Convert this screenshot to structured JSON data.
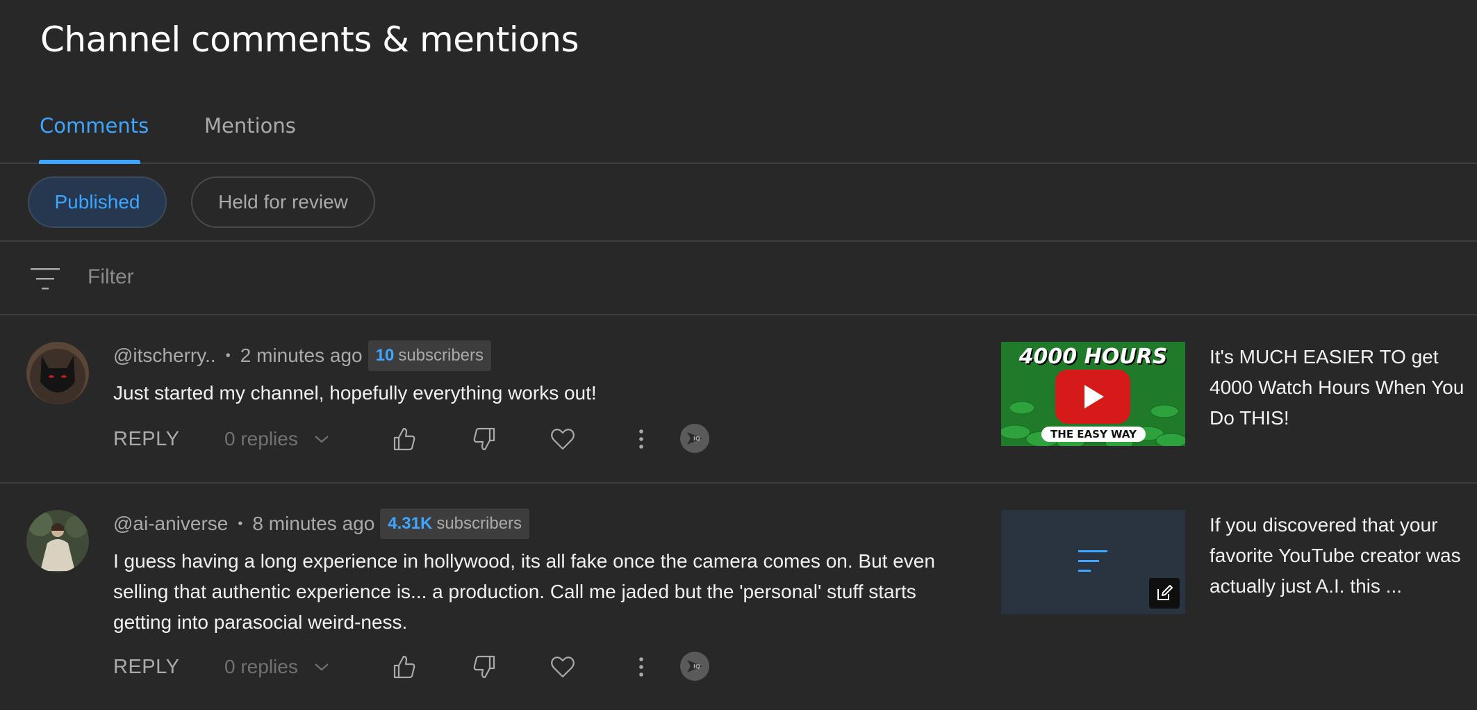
{
  "page": {
    "title": "Channel comments & mentions"
  },
  "tabs": [
    {
      "label": "Comments",
      "active": true
    },
    {
      "label": "Mentions",
      "active": false
    }
  ],
  "chips": [
    {
      "label": "Published",
      "active": true
    },
    {
      "label": "Held for review",
      "active": false
    }
  ],
  "filter": {
    "placeholder": "Filter",
    "value": "",
    "icon": "filter-icon"
  },
  "colors": {
    "accent": "#3ea6ff",
    "background": "#282828",
    "divider": "#3e3e3e"
  },
  "comments": [
    {
      "handle": "@itscherry..",
      "separator": "•",
      "time": "2 minutes ago",
      "subscriber_count": "10",
      "subscriber_label": "subscribers",
      "text": "Just started my channel, hopefully everything works out!",
      "reply_label": "REPLY",
      "replies_label": "0 replies",
      "video": {
        "thumbnail_top_text": "4000 HOURS",
        "thumbnail_bottom_text": "THE EASY WAY",
        "title": "It's MUCH EASIER TO get 4000 Watch Hours When You Do THIS!"
      }
    },
    {
      "handle": "@ai-aniverse",
      "separator": "•",
      "time": "8 minutes ago",
      "subscriber_count": "4.31K",
      "subscriber_label": "subscribers",
      "text": "I guess having a long experience in hollywood, its all fake once the camera comes on. But even selling that authentic experience is... a production. Call me jaded but the 'personal' stuff starts getting into parasocial weird-ness.",
      "reply_label": "REPLY",
      "replies_label": "0 replies",
      "video": {
        "title": "If you discovered that your favorite YouTube creator was actually just A.I. this ..."
      }
    }
  ]
}
